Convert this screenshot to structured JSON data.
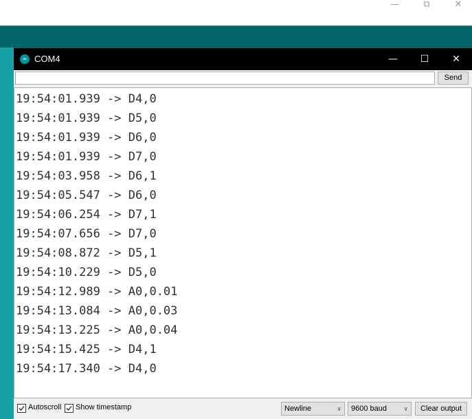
{
  "parent_window": {
    "controls": {
      "minimize": "—",
      "restore": "⧉",
      "close": "✕"
    },
    "toolbar_color": "#006468",
    "accent_color": "#17a1a5",
    "serial_monitor_icon": "magnifier-icon"
  },
  "monitor": {
    "title": "COM4",
    "logo": "∞",
    "controls": {
      "minimize": "—",
      "maximize": "☐",
      "close": "✕"
    },
    "send": {
      "input_value": "",
      "button_label": "Send"
    },
    "output_lines": [
      "19:54:01.939 -> D4,0",
      "19:54:01.939 -> D5,0",
      "19:54:01.939 -> D6,0",
      "19:54:01.939 -> D7,0",
      "19:54:03.958 -> D6,1",
      "19:54:05.547 -> D6,0",
      "19:54:06.254 -> D7,1",
      "19:54:07.656 -> D7,0",
      "19:54:08.872 -> D5,1",
      "19:54:10.229 -> D5,0",
      "19:54:12.989 -> A0,0.01",
      "19:54:13.084 -> A0,0.03",
      "19:54:13.225 -> A0,0.04",
      "19:54:15.425 -> D4,1",
      "19:54:17.340 -> D4,0"
    ],
    "status_bar": {
      "autoscroll": {
        "label": "Autoscroll",
        "checked": true
      },
      "show_timestamp": {
        "label": "Show timestamp",
        "checked": true
      },
      "line_ending": "Newline",
      "baud_rate": "9600 baud",
      "clear_button": "Clear output"
    }
  }
}
